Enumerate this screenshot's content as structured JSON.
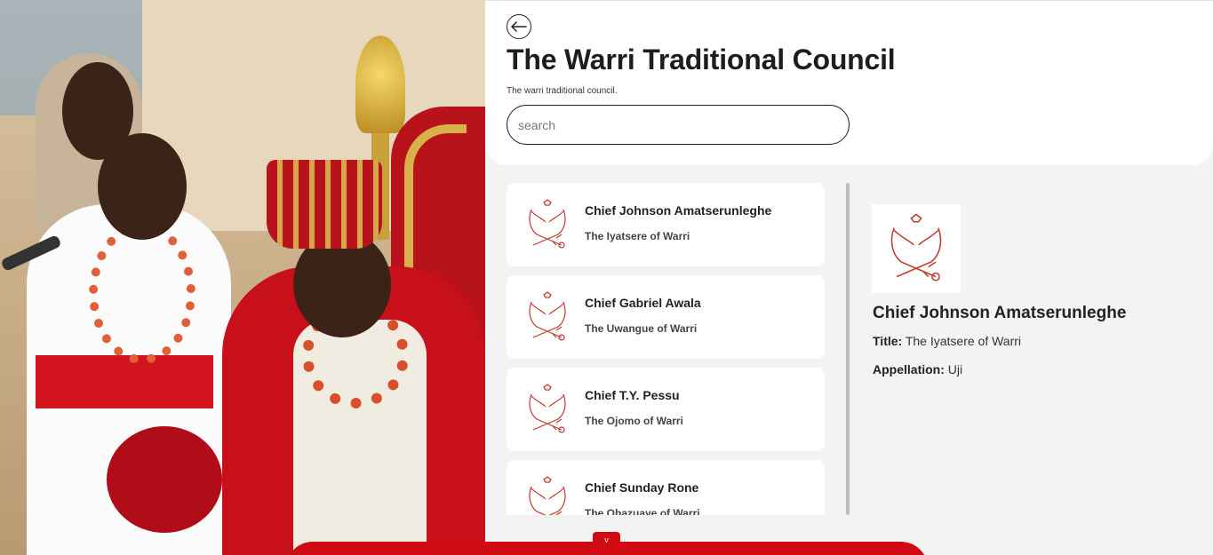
{
  "header": {
    "title": "The Warri Traditional Council",
    "subtitle": "The warri traditional council.",
    "back_icon": "arrow-left-icon"
  },
  "search": {
    "placeholder": "search",
    "value": ""
  },
  "chiefs": [
    {
      "name": "Chief Johnson Amatserunleghe",
      "role": "The Iyatsere of Warri"
    },
    {
      "name": "Chief Gabriel Awala",
      "role": "The Uwangue of Warri"
    },
    {
      "name": "Chief T.Y. Pessu",
      "role": "The Ojomo of Warri"
    },
    {
      "name": "Chief Sunday Rone",
      "role": "The Obazuaye of Warri"
    }
  ],
  "detail": {
    "name": "Chief Johnson Amatserunleghe",
    "title_label": "Title:",
    "title_value": "The Iyatsere of Warri",
    "appellation_label": "Appellation:",
    "appellation_value": "Uji"
  },
  "bottom": {
    "toggle_label": "v"
  },
  "colors": {
    "accent": "#cf0a12",
    "emblem": "#c0392b"
  }
}
